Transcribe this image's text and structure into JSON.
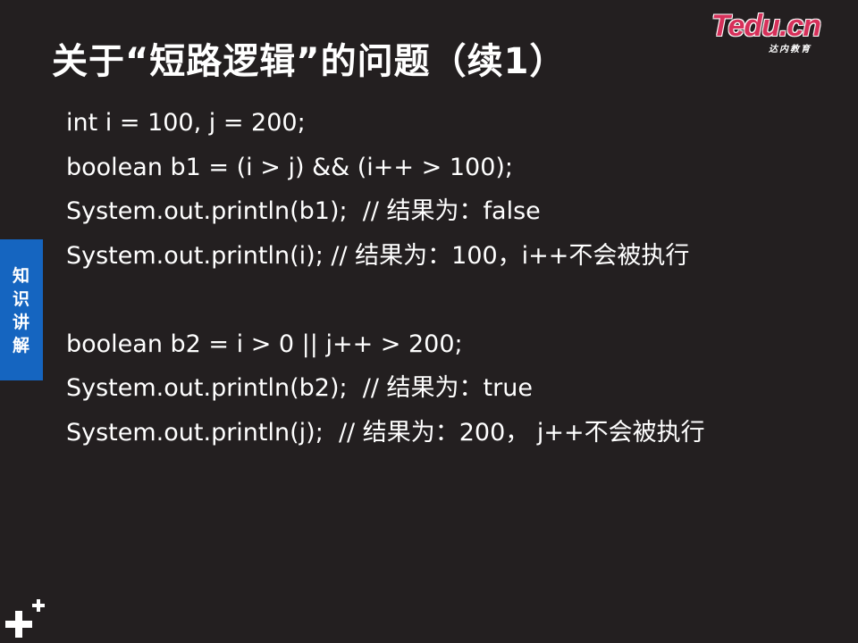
{
  "slide": {
    "title": "关于“短路逻辑”的问题（续1）"
  },
  "logo": {
    "brand": "Tedu.cn",
    "sub": "达内教育"
  },
  "side_tab": {
    "label": "知识讲解"
  },
  "code_lines": [
    "int i = 100, j = 200;",
    "boolean b1 = (i > j) && (i++ > 100);",
    "System.out.println(b1);  // 结果为：false",
    "System.out.println(i); // 结果为：100，i++不会被执行",
    "",
    "boolean b2 = i > 0 || j++ > 200;",
    "System.out.println(b2);  // 结果为：true",
    "System.out.println(j);  // 结果为：200， j++不会被执行"
  ],
  "colors": {
    "background": "#231f20",
    "side_tab": "#1565c0",
    "logo_accent": "#d6305a",
    "text": "#ffffff"
  },
  "icons": {
    "corner": "plus-plus-icon"
  }
}
